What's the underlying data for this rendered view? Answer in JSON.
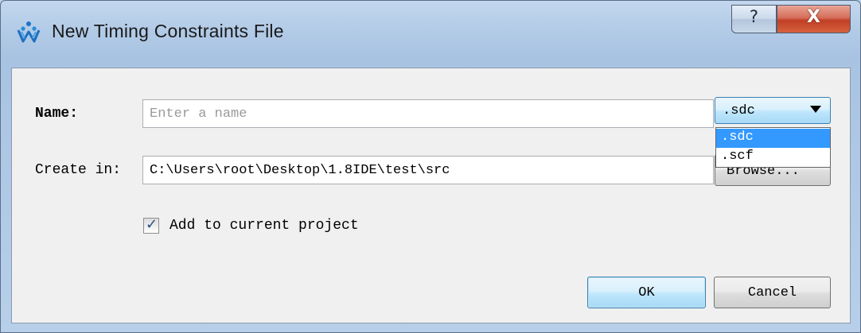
{
  "window": {
    "title": "New Timing Constraints File",
    "app_icon": "gowin-logo-icon",
    "help_glyph": "?",
    "close_glyph": "X",
    "accent_color": "#3399ff"
  },
  "form": {
    "name_label": "Name:",
    "name_value": "",
    "name_placeholder": "Enter a name",
    "create_in_label": "Create in:",
    "create_in_value": "C:\\Users\\root\\Desktop\\1.8IDE\\test\\src",
    "browse_label": "Browse...",
    "extension": {
      "selected": ".sdc",
      "options": [
        ".sdc",
        ".scf"
      ],
      "expanded": true
    },
    "add_to_project": {
      "label": "Add to current project",
      "checked": true
    }
  },
  "buttons": {
    "ok_label": "OK",
    "cancel_label": "Cancel"
  }
}
